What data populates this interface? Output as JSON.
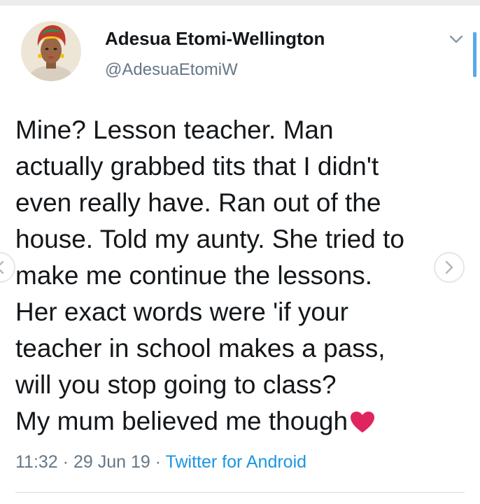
{
  "tweet": {
    "author": {
      "display_name": "Adesua Etomi-Wellington",
      "handle": "@AdesuaEtomiW"
    },
    "text": "Mine? Lesson teacher. Man\nactually grabbed tits that I didn't\neven really have. Ran out of the\nhouse. Told my aunty. She tried to\nmake me continue the lessons.\nHer exact words were 'if your\nteacher in school makes a pass,\nwill you stop going to class?\nMy mum believed me though",
    "emoji": "red-heart",
    "time": "11:32",
    "date": "29 Jun 19",
    "separator": "·",
    "source": "Twitter for Android"
  },
  "icons": {
    "menu": "chevron-down-icon",
    "prev": "chevron-left-icon",
    "next": "chevron-right-icon"
  },
  "colors": {
    "text": "#14171a",
    "muted": "#657786",
    "link": "#1b95e0",
    "heart": "#e0245e",
    "scroll_indicator": "#5aa9e6"
  }
}
